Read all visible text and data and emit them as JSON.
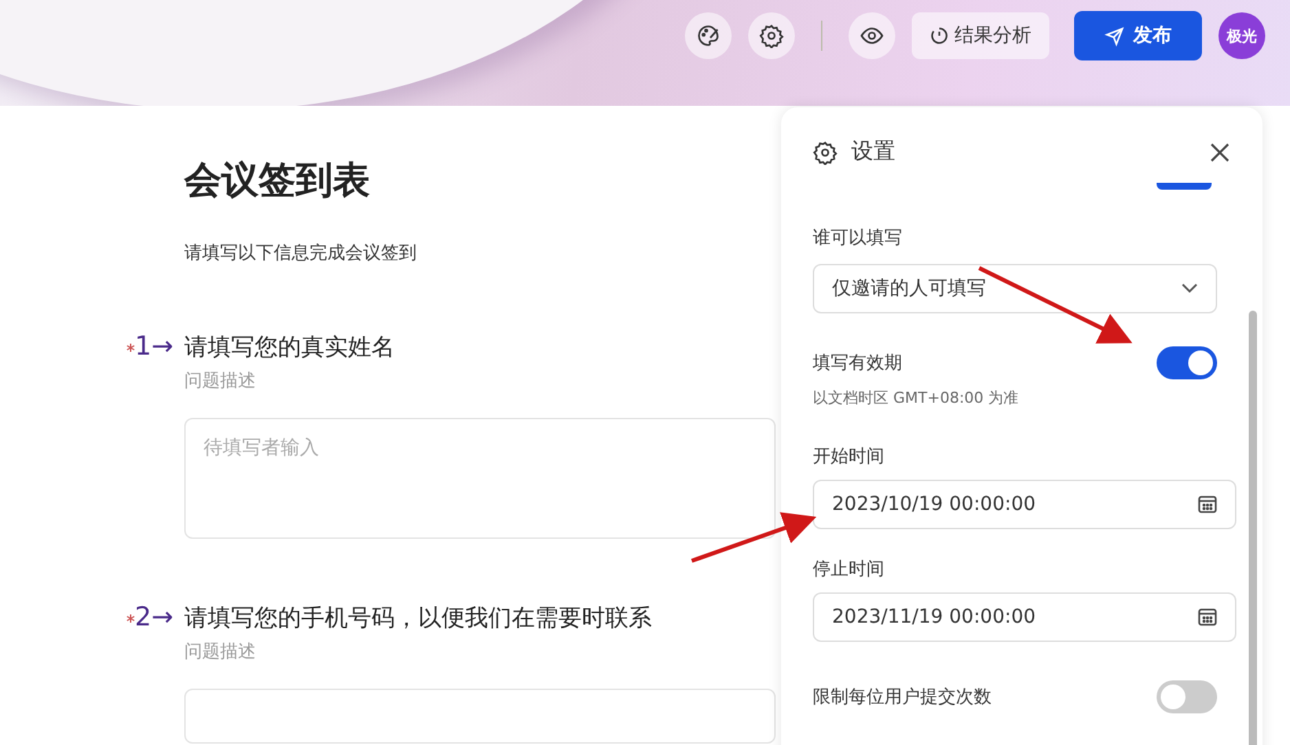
{
  "toolbar": {
    "result_button": "结果分析",
    "publish_button": "发布",
    "avatar": "极光"
  },
  "form": {
    "title": "会议签到表",
    "description": "请填写以下信息完成会议签到",
    "questions": [
      {
        "number": "1→",
        "required": true,
        "title": "请填写您的真实姓名",
        "hint": "问题描述",
        "placeholder": "待填写者输入"
      },
      {
        "number": "2→",
        "required": true,
        "title": "请填写您的手机号码，以便我们在需要时联系",
        "hint": "问题描述"
      }
    ]
  },
  "settings": {
    "title": "设置",
    "top_toggle_on": true,
    "who_label": "谁可以填写",
    "who_value": "仅邀请的人可填写",
    "validity": {
      "label": "填写有效期",
      "on": true,
      "note": "以文档时区 GMT+08:00 为准"
    },
    "start": {
      "label": "开始时间",
      "value": "2023/10/19 00:00:00"
    },
    "end": {
      "label": "停止时间",
      "value": "2023/11/19 00:00:00"
    },
    "limit": {
      "label": "限制每位用户提交次数",
      "on": false
    }
  }
}
